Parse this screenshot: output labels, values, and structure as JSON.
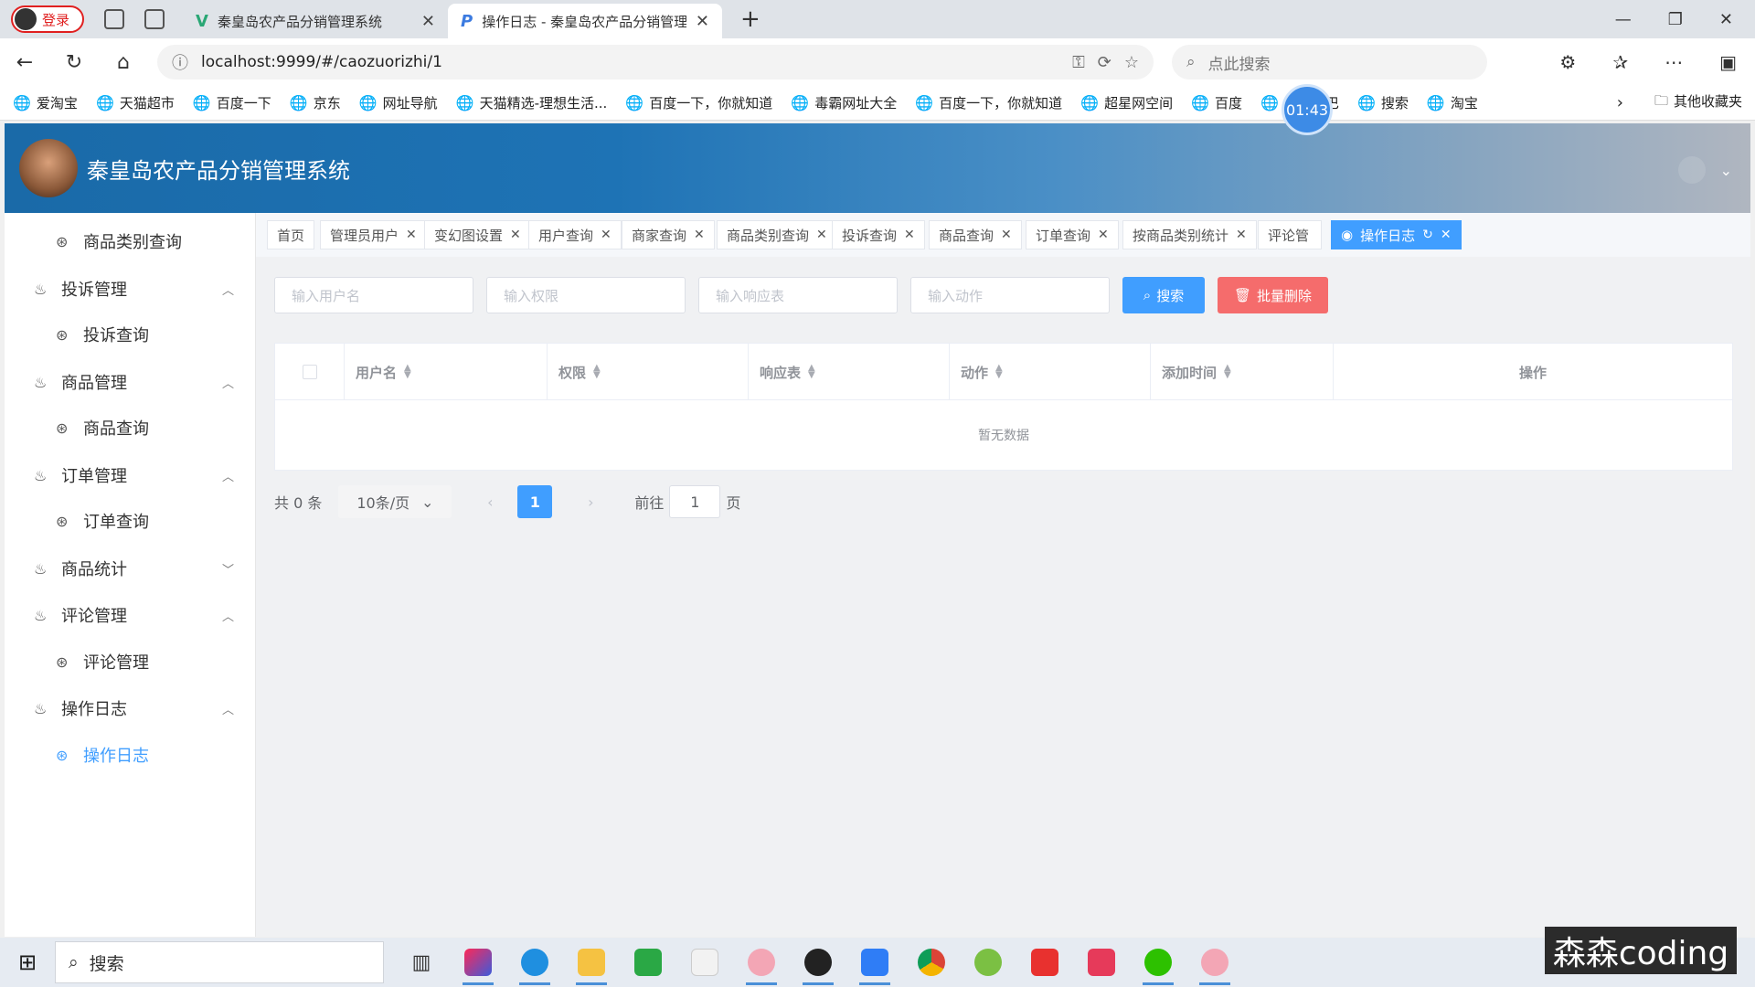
{
  "browser": {
    "login_label": "登录",
    "tabs": [
      {
        "title": "秦皇岛农产品分销管理系统",
        "favicon": "vue-icon"
      },
      {
        "title": "操作日志 - 秦皇岛农产品分销管理",
        "favicon": "p-icon"
      }
    ],
    "url": "localhost:9999/#/caozuorizhi/1",
    "search_placeholder": "点此搜索",
    "bookmarks": [
      "爱淘宝",
      "天猫超市",
      "百度一下",
      "京东",
      "网址导航",
      "天猫精选-理想生活...",
      "百度一下，你就知道",
      "毒霸网址大全",
      "百度一下，你就知道",
      "超星网空间",
      "百度",
      "阿里巴巴",
      "搜索",
      "淘宝"
    ],
    "other_bookmarks": "其他收藏夹"
  },
  "app": {
    "title": "秦皇岛农产品分销管理系统",
    "sidebar": [
      {
        "label": "商品类别查询",
        "type": "sub",
        "active": false
      },
      {
        "label": "投诉管理",
        "type": "group",
        "arrow": "up"
      },
      {
        "label": "投诉查询",
        "type": "sub",
        "active": false
      },
      {
        "label": "商品管理",
        "type": "group",
        "arrow": "up"
      },
      {
        "label": "商品查询",
        "type": "sub",
        "active": false
      },
      {
        "label": "订单管理",
        "type": "group",
        "arrow": "up"
      },
      {
        "label": "订单查询",
        "type": "sub",
        "active": false
      },
      {
        "label": "商品统计",
        "type": "group",
        "arrow": "down"
      },
      {
        "label": "评论管理",
        "type": "group",
        "arrow": "up"
      },
      {
        "label": "评论管理",
        "type": "sub",
        "active": false
      },
      {
        "label": "操作日志",
        "type": "group",
        "arrow": "up"
      },
      {
        "label": "操作日志",
        "type": "sub",
        "active": true
      }
    ],
    "tags": [
      {
        "label": "首页",
        "closable": false
      },
      {
        "label": "管理员用户",
        "closable": true
      },
      {
        "label": "变幻图设置",
        "closable": true
      },
      {
        "label": "用户查询",
        "closable": true
      },
      {
        "label": "商家查询",
        "closable": true
      },
      {
        "label": "商品类别查询",
        "closable": true
      },
      {
        "label": "投诉查询",
        "closable": true
      },
      {
        "label": "商品查询",
        "closable": true
      },
      {
        "label": "订单查询",
        "closable": true
      },
      {
        "label": "按商品类别统计",
        "closable": true
      },
      {
        "label": "评论管",
        "closable": false
      },
      {
        "label": "操作日志",
        "closable": true,
        "active": true
      }
    ],
    "timer": "01:43",
    "filters": {
      "username_placeholder": "输入用户名",
      "permission_placeholder": "输入权限",
      "table_placeholder": "输入响应表",
      "action_placeholder": "输入动作",
      "search_label": "搜索",
      "batch_delete_label": "批量删除"
    },
    "table": {
      "columns": [
        "用户名",
        "权限",
        "响应表",
        "动作",
        "添加时间",
        "操作"
      ],
      "empty_text": "暂无数据"
    },
    "pagination": {
      "total": "共 0 条",
      "page_size": "10条/页",
      "current_page": "1",
      "goto_label": "前往",
      "goto_value": "1",
      "page_suffix": "页"
    }
  },
  "taskbar": {
    "search_label": "搜索",
    "watermark": "森森coding"
  },
  "colors": {
    "primary": "#409eff",
    "danger": "#f56c6c",
    "header": "#1e73b5"
  }
}
